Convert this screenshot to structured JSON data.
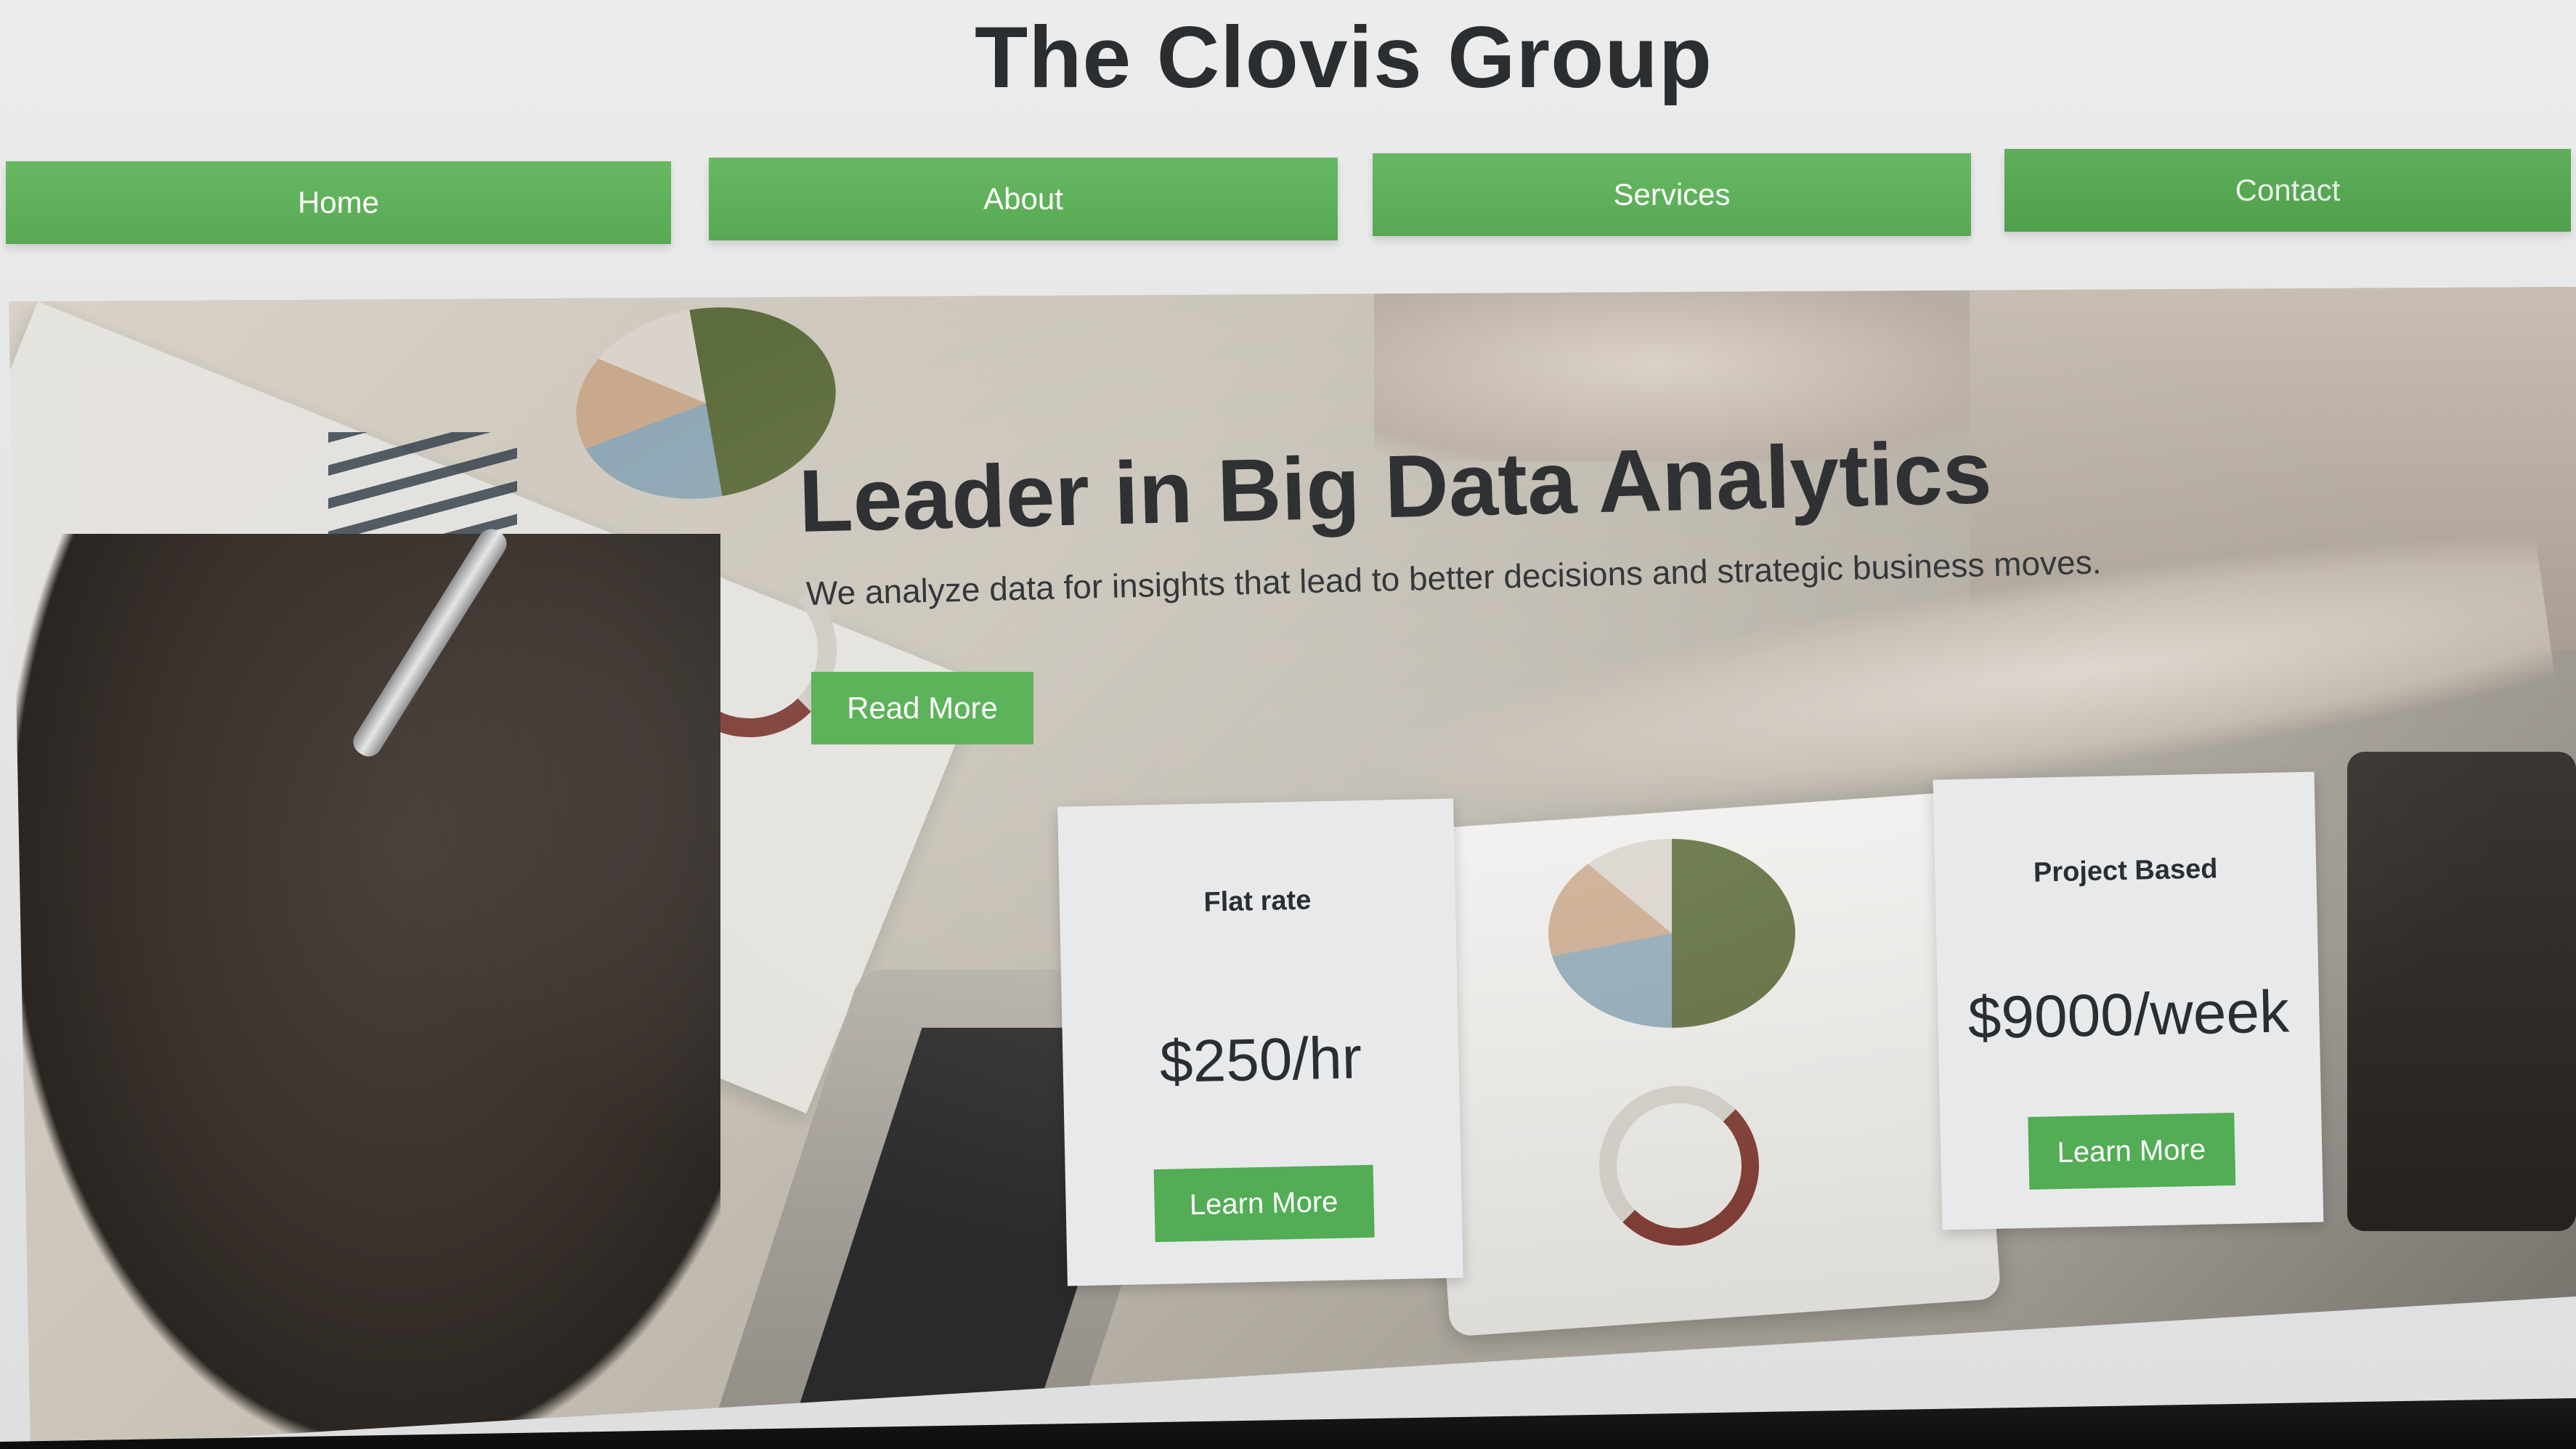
{
  "site": {
    "title": "The Clovis Group"
  },
  "nav": {
    "items": [
      {
        "label": "Home"
      },
      {
        "label": "About"
      },
      {
        "label": "Services"
      },
      {
        "label": "Contact"
      }
    ]
  },
  "hero": {
    "title": "Leader in Big Data Analytics",
    "subtitle": "We analyze data for insights that lead to better decisions and strategic business moves.",
    "cta_label": "Read More"
  },
  "pricing": {
    "cards": [
      {
        "title": "Flat rate",
        "price": "$250/hr",
        "button_label": "Learn More"
      },
      {
        "title": "Project Based",
        "price": "$9000/week",
        "button_label": "Learn More"
      }
    ]
  },
  "colors": {
    "accent_green": "#5db35a",
    "title_text": "#2b2e31",
    "card_background": "#e8e9ea"
  }
}
